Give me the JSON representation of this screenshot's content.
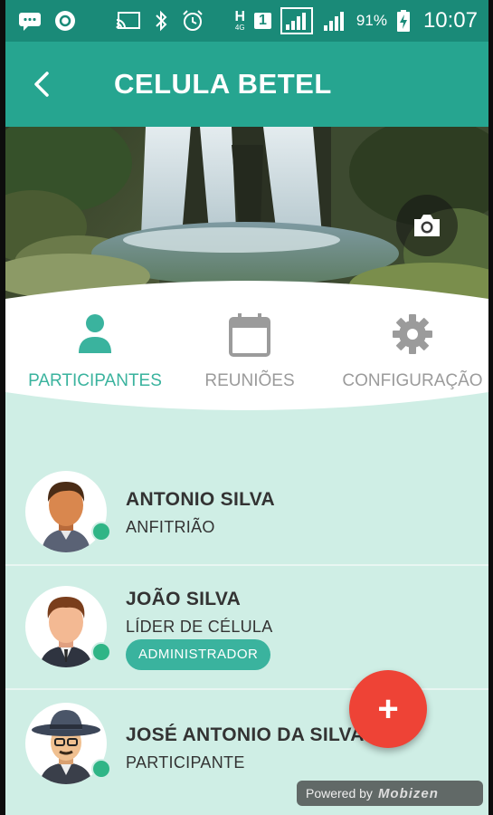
{
  "status_bar": {
    "network": "H",
    "network_sub": "4G",
    "sim_slot": "1",
    "battery": "91%",
    "time": "10:07"
  },
  "app_bar": {
    "title": "CELULA BETEL",
    "back_icon": "back-arrow-icon"
  },
  "cover": {
    "camera_icon": "camera-icon"
  },
  "tabs": [
    {
      "label": "PARTICIPANTES",
      "icon": "person-icon",
      "active": true
    },
    {
      "label": "REUNIÕES",
      "icon": "calendar-icon",
      "active": false
    },
    {
      "label": "CONFIGURAÇÃO",
      "icon": "gear-icon",
      "active": false
    }
  ],
  "participants": [
    {
      "name": "ANTONIO SILVA",
      "role": "ANFITRIÃO",
      "badge": ""
    },
    {
      "name": "JOÃO SILVA",
      "role": "LÍDER DE CÉLULA",
      "badge": "ADMINISTRADOR"
    },
    {
      "name": "JOSÉ ANTONIO DA SILVA",
      "role": "PARTICIPANTE",
      "badge": ""
    }
  ],
  "fab": {
    "label": "+"
  },
  "watermark": {
    "text": "Powered by",
    "brand": "Mobizen"
  },
  "colors": {
    "primary": "#26a590",
    "primary_dark": "#1a8a78",
    "accent": "#ee4336",
    "list_bg": "#cfeee5",
    "online": "#2fb586"
  }
}
